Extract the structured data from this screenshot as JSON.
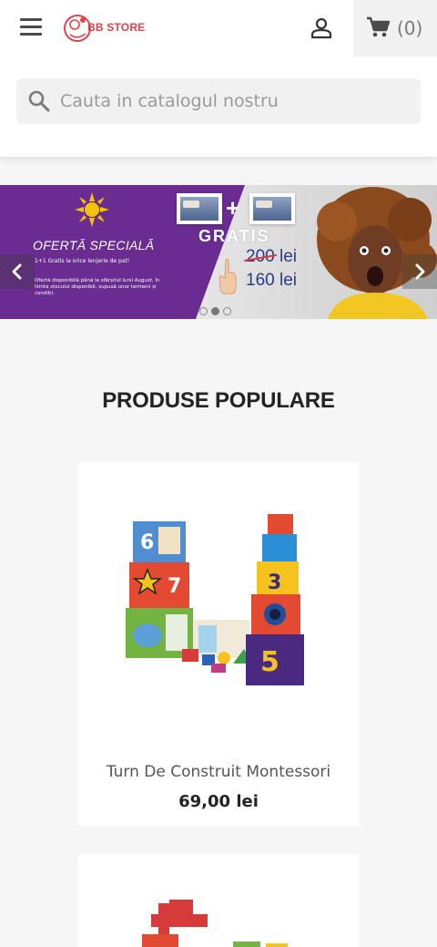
{
  "header": {
    "menu_icon": "hamburger-menu-icon",
    "logo_text": "BB STORE",
    "user_icon": "user-icon",
    "cart_icon": "shopping-cart-icon",
    "cart_count": "(0)"
  },
  "search": {
    "placeholder": "Cauta in catalogul nostru",
    "icon": "search-icon"
  },
  "banner": {
    "offer_title": "OFERTĂ SPECIALĂ",
    "offer_line": "1+1 Gratis la orice lenjerie de pat!",
    "offer_small": "Ofertă disponibilă până la sfârșitul lunii August, în limita stocului disponibil, supusă unor termeni și condiții.",
    "gratis": "GRATIS",
    "old_price_num": "200",
    "old_price_unit": " lei",
    "new_price": "160 lei",
    "slide_count": 3,
    "active_slide": 2
  },
  "section": {
    "title": "PRODUSE POPULARE"
  },
  "products": [
    {
      "name": "Turn De Construit Montessori",
      "price": "69,00 lei"
    }
  ],
  "colors": {
    "brand": "#e0434b",
    "banner_purple": "#6a2c91",
    "background": "#f6f6f6"
  }
}
